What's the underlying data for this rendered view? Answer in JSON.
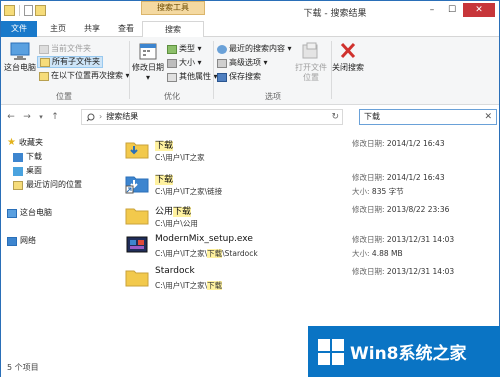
{
  "window": {
    "title": "下载 - 搜索结果",
    "context_tab_title": "搜索工具",
    "controls": {
      "minimize": "–",
      "maximize": "☐",
      "close": "✕"
    }
  },
  "tabs": {
    "file": "文件",
    "home": "主页",
    "share": "共享",
    "view": "查看",
    "search": "搜索"
  },
  "ribbon": {
    "location": {
      "label": "位置",
      "this_pc": "这台电脑",
      "current_folder": "当前文件夹",
      "all_subfolders": "所有子文件夹",
      "search_again_in": "在以下位置再次搜索 ▾"
    },
    "refine": {
      "label": "优化",
      "date_modified": "修改日期 ▾",
      "kind": "类型 ▾",
      "size": "大小 ▾",
      "other_properties": "其他属性 ▾"
    },
    "options": {
      "label": "选项",
      "recent_searches": "最近的搜索内容 ▾",
      "advanced_options": "高级选项 ▾",
      "save_search": "保存搜索",
      "open_file_location": "打开文件位置"
    },
    "close": {
      "close_search": "关闭搜索"
    }
  },
  "address": {
    "back": "←",
    "forward": "→",
    "recent": "▾",
    "up": "↑",
    "breadcrumb": "搜索结果",
    "refresh": "↻",
    "search_value": "下载",
    "search_clear": "✕"
  },
  "nav": {
    "favorites": "收藏夹",
    "downloads": "下载",
    "desktop": "桌面",
    "recent_places": "最近访问的位置",
    "this_pc": "这台电脑",
    "network": "网络"
  },
  "results": [
    {
      "name": "下载",
      "path_pre": "C:\\用户\\IT之家",
      "path_hl": "",
      "path_post": "",
      "meta1_label": "修改日期:",
      "meta1_value": "2014/1/2 16:43",
      "meta2_label": "",
      "meta2_value": ""
    },
    {
      "name": "下载",
      "path_pre": "C:\\用户\\IT之家\\链接",
      "path_hl": "",
      "path_post": "",
      "meta1_label": "修改日期:",
      "meta1_value": "2014/1/2 16:43",
      "meta2_label": "大小:",
      "meta2_value": "835 字节"
    },
    {
      "name_pre": "公用",
      "name": "下载",
      "path_pre": "C:\\用户\\公用",
      "path_hl": "",
      "path_post": "",
      "meta1_label": "修改日期:",
      "meta1_value": "2013/8/22 23:36",
      "meta2_label": "",
      "meta2_value": ""
    },
    {
      "name": "ModernMix_setup.exe",
      "path_pre": "C:\\用户\\IT之家\\",
      "path_hl": "下载",
      "path_post": "\\Stardock",
      "meta1_label": "修改日期:",
      "meta1_value": "2013/12/31 14:03",
      "meta2_label": "大小:",
      "meta2_value": "4.88 MB"
    },
    {
      "name": "Stardock",
      "path_pre": "C:\\用户\\IT之家\\",
      "path_hl": "下载",
      "path_post": "",
      "meta1_label": "修改日期:",
      "meta1_value": "2013/12/31 14:03",
      "meta2_label": "",
      "meta2_value": ""
    }
  ],
  "status": {
    "count": "5 个项目"
  },
  "watermark": {
    "text": "Win8系统之家"
  },
  "colors": {
    "accent": "#1979ca",
    "context_tab": "#f4d9a1",
    "highlight": "#fff2a0",
    "watermark": "#0a74c4"
  }
}
